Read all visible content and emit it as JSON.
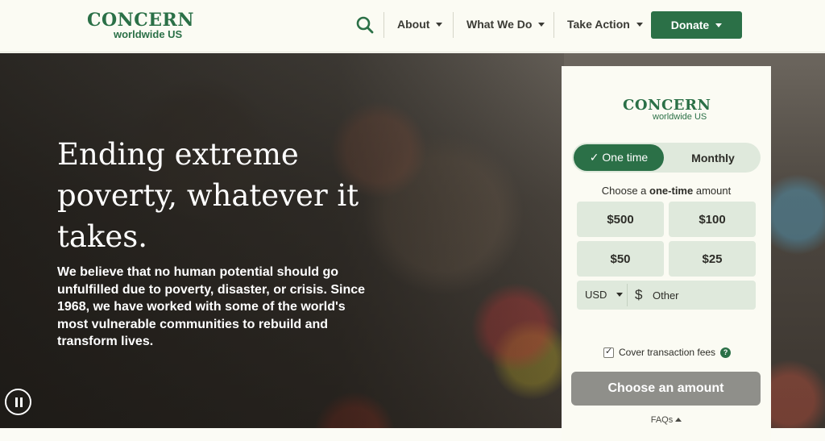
{
  "header": {
    "logo_main": "CONCERN",
    "logo_sub": "worldwide US",
    "nav": [
      {
        "label": "About"
      },
      {
        "label": "What We Do"
      },
      {
        "label": "Take Action"
      }
    ],
    "donate_label": "Donate",
    "search_icon": "search-icon"
  },
  "hero": {
    "title": "Ending extreme poverty, whatever it takes.",
    "body": "We believe that no human potential should go unfulfilled due to poverty, disaster, or crisis. Since 1968, we have worked with some of the world's most vulnerable communities to rebuild and transform lives.",
    "pause_icon": "pause-icon"
  },
  "donation_card": {
    "logo_main": "CONCERN",
    "logo_sub": "worldwide US",
    "frequency": {
      "one_time": "✓ One time",
      "monthly": "Monthly",
      "selected": "One time"
    },
    "choose_prefix": "Choose a",
    "choose_bold": "one-time",
    "choose_suffix": "amount",
    "amounts": [
      "$500",
      "$100",
      "$50",
      "$25"
    ],
    "currency": "USD",
    "currency_symbol": "$",
    "other_placeholder": "Other",
    "cover_fees_label": "Cover transaction fees",
    "cover_fees_checked": true,
    "cta_label": "Choose an amount",
    "faqs_label": "FAQs"
  },
  "colors": {
    "brand_green": "#2b7047",
    "light_green": "#dfe9dc",
    "disabled_cta": "#8f8f8a"
  }
}
